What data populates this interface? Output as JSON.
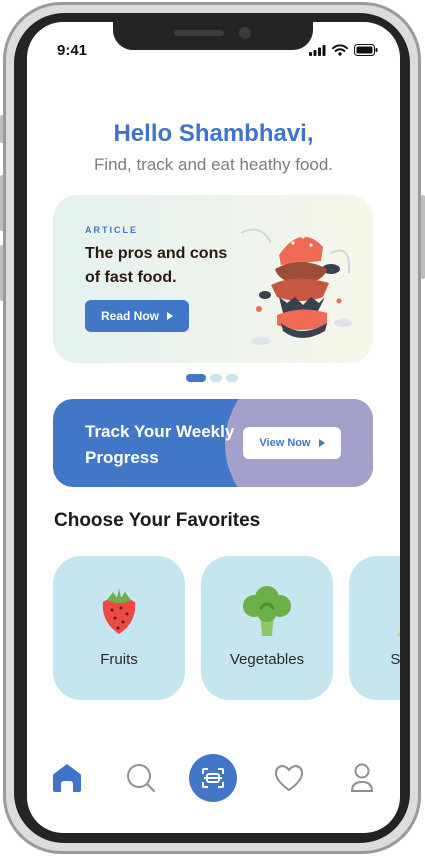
{
  "status_bar": {
    "time": "9:41"
  },
  "header": {
    "greeting": "Hello Shambhavi,",
    "subtitle": "Find, track and eat heathy food."
  },
  "article": {
    "tag": "ARTICLE",
    "title": "The pros and cons of fast food.",
    "button_label": "Read Now"
  },
  "carousel": {
    "page_count": 3,
    "active_index": 0
  },
  "progress": {
    "title": "Track Your Weekly Progress",
    "button_label": "View Now"
  },
  "favorites": {
    "title": "Choose Your Favorites",
    "items": [
      {
        "label": "Fruits",
        "icon": "strawberry-icon"
      },
      {
        "label": "Vegetables",
        "icon": "broccoli-icon"
      },
      {
        "label": "Snacks",
        "icon": "snack-icon"
      }
    ]
  },
  "nav": {
    "items": [
      "home-icon",
      "search-icon",
      "scan-icon",
      "heart-icon",
      "profile-icon"
    ],
    "active": "home-icon"
  },
  "colors": {
    "accent": "#4277c7",
    "progress_blob": "#a4a0cc",
    "card_light_blue": "#c6e6ef"
  }
}
